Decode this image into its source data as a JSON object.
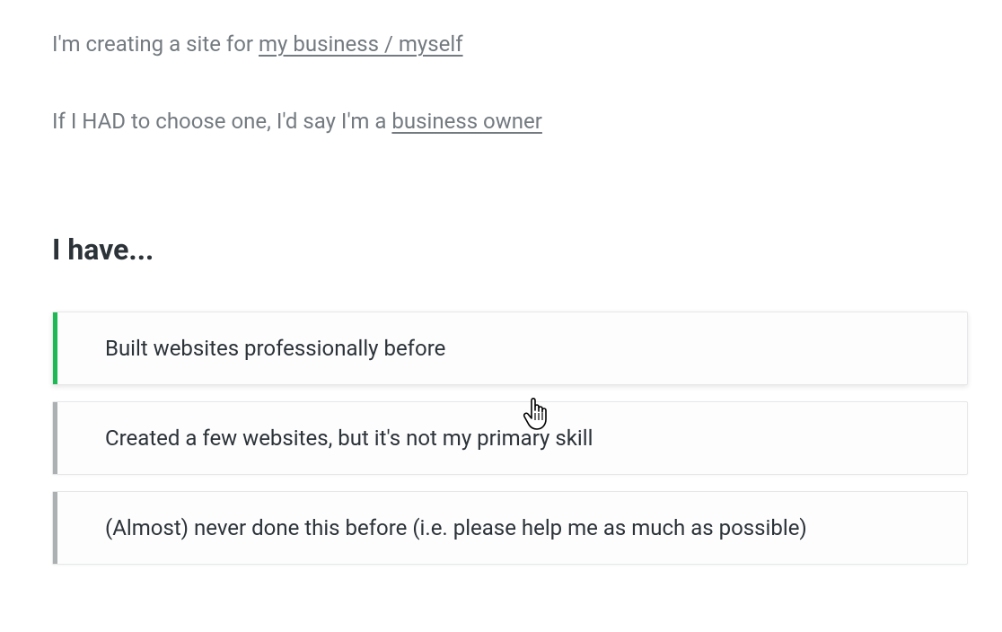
{
  "statements": {
    "line1": {
      "prefix": "I'm creating a site for ",
      "value": "my business / myself"
    },
    "line2": {
      "prefix": "If I HAD to choose one, I'd say I'm a ",
      "value": "business owner"
    }
  },
  "question": "I have...",
  "options": {
    "opt0": "Built websites professionally before",
    "opt1": "Created a few websites, but it's not my primary skill",
    "opt2": "(Almost) never done this before (i.e. please help me as much as possible)"
  },
  "colors": {
    "accent": "#1db954",
    "neutralStripe": "#adb0b2",
    "muted": "#737a80",
    "text": "#2b3238"
  }
}
